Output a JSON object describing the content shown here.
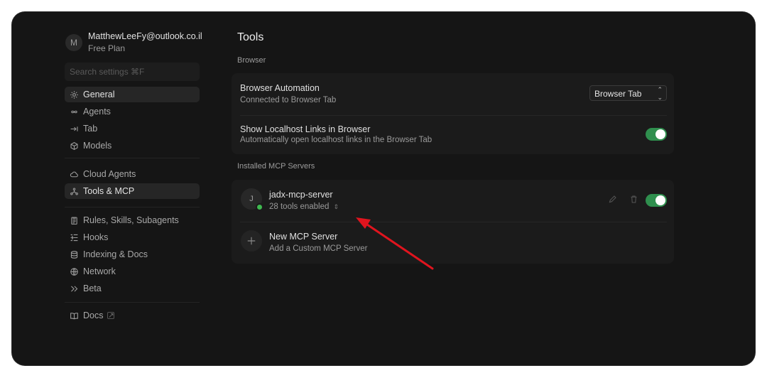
{
  "account": {
    "initial": "M",
    "email": "MatthewLeeFy@outlook.co.il",
    "plan": "Free Plan"
  },
  "search": {
    "placeholder": "Search settings ⌘F"
  },
  "sidebar": {
    "group1": [
      {
        "label": "General",
        "icon": "gear-icon",
        "active": true
      },
      {
        "label": "Agents",
        "icon": "infinity-icon"
      },
      {
        "label": "Tab",
        "icon": "arrow-right-bar-icon"
      },
      {
        "label": "Models",
        "icon": "cube-icon"
      }
    ],
    "group2": [
      {
        "label": "Cloud Agents",
        "icon": "cloud-icon"
      },
      {
        "label": "Tools & MCP",
        "icon": "nodes-icon",
        "active": true
      }
    ],
    "group3": [
      {
        "label": "Rules, Skills, Subagents",
        "icon": "clipboard-icon"
      },
      {
        "label": "Hooks",
        "icon": "hooks-icon"
      },
      {
        "label": "Indexing & Docs",
        "icon": "database-icon"
      },
      {
        "label": "Network",
        "icon": "globe-icon"
      },
      {
        "label": "Beta",
        "icon": "double-chevron-icon"
      }
    ],
    "group4": [
      {
        "label": "Docs",
        "icon": "book-icon"
      }
    ]
  },
  "main": {
    "title": "Tools",
    "browser_section": "Browser",
    "browser_automation": {
      "title": "Browser Automation",
      "subtitle": "Connected to Browser Tab",
      "select_value": "Browser Tab"
    },
    "localhost_links": {
      "title": "Show Localhost Links in Browser",
      "subtitle": "Automatically open localhost links in the Browser Tab",
      "enabled": true
    },
    "mcp_section": "Installed MCP Servers",
    "server": {
      "initial": "J",
      "name": "jadx-mcp-server",
      "tools": "28 tools enabled",
      "enabled": true
    },
    "new_server": {
      "title": "New MCP Server",
      "subtitle": "Add a Custom MCP Server"
    }
  },
  "colors": {
    "toggle_on": "#2f8f4e",
    "status_ok": "#3fb950",
    "annotation_arrow": "#e0141e"
  }
}
